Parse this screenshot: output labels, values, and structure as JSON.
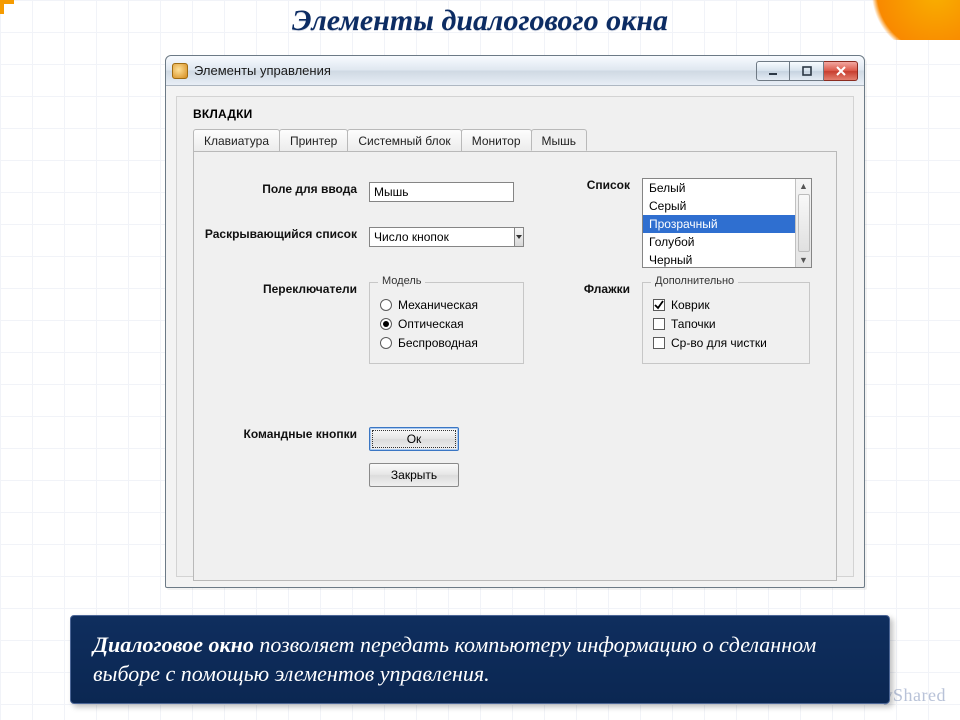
{
  "slide": {
    "title": "Элементы диалогового окна"
  },
  "window": {
    "title": "Элементы управления",
    "section_label": "ВКЛАДКИ",
    "tabs": [
      "Клавиатура",
      "Принтер",
      "Системный блок",
      "Монитор",
      "Мышь"
    ],
    "active_tab_index": 4
  },
  "labels": {
    "input": "Поле для ввода",
    "combo": "Раскрывающийся список",
    "radios": "Переключатели",
    "list": "Список",
    "checks": "Флажки",
    "cmd": "Командные кнопки"
  },
  "input": {
    "value": "Мышь"
  },
  "combo": {
    "value": "Число кнопок"
  },
  "radios": {
    "legend": "Модель",
    "options": [
      "Механическая",
      "Оптическая",
      "Беспроводная"
    ],
    "selected_index": 1
  },
  "listbox": {
    "options": [
      "Белый",
      "Серый",
      "Прозрачный",
      "Голубой",
      "Черный"
    ],
    "selected_index": 2
  },
  "checks": {
    "legend": "Дополнительно",
    "options": [
      "Коврик",
      "Тапочки",
      "Ср-во для чистки"
    ],
    "checked": [
      true,
      false,
      false
    ]
  },
  "buttons": {
    "ok": "Ок",
    "close": "Закрыть"
  },
  "caption": {
    "lead": "Диалоговое окно",
    "rest": " позволяет передать компьютеру информацию о сделанном выборе с помощью элементов управления."
  },
  "watermark": "MyShared"
}
